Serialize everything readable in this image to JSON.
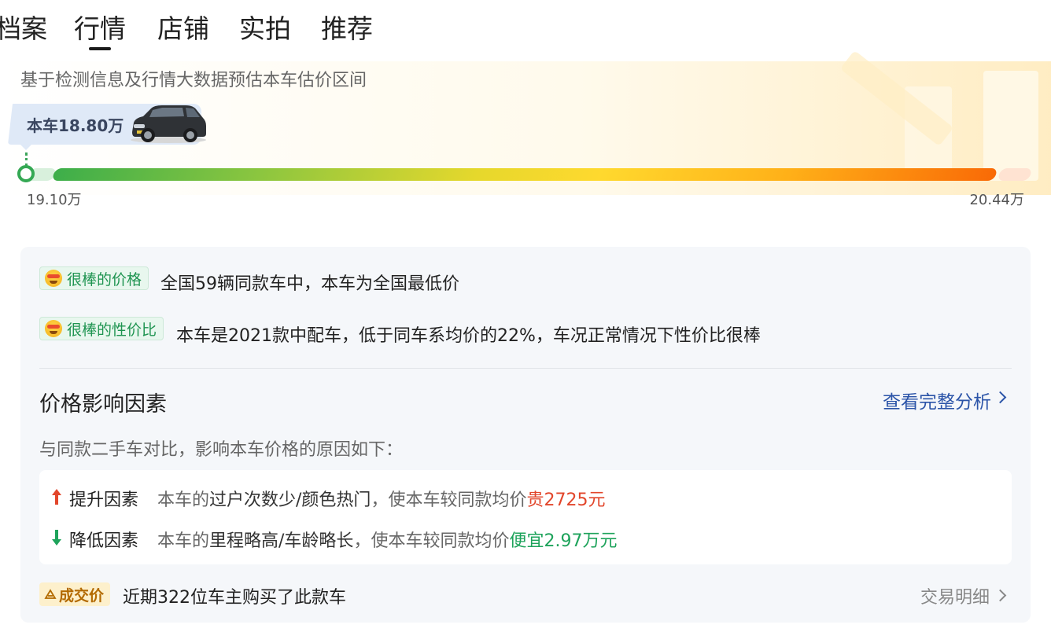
{
  "tabs": [
    {
      "label": "档案"
    },
    {
      "label": "行情",
      "active": true
    },
    {
      "label": "店铺"
    },
    {
      "label": "实拍"
    },
    {
      "label": "推荐"
    }
  ],
  "hero": {
    "subtitle": "基于检测信息及行情大数据预估本车估价区间",
    "car_price_label": "本车18.80万",
    "range_min": "19.10万",
    "range_max": "20.44万"
  },
  "highlights": [
    {
      "badge": "很棒的价格",
      "text": "全国59辆同款车中，本车为全国最低价"
    },
    {
      "badge": "很棒的性价比",
      "text": "本车是2021款中配车，低于同车系均价的22%，车况正常情况下性价比很棒"
    }
  ],
  "factors_section": {
    "title": "价格影响因素",
    "link": "查看完整分析",
    "desc": "与同款二手车对比，影响本车价格的原因如下：",
    "up": {
      "label": "提升因素",
      "prefix": "本车的",
      "items": "过户次数少/颜色热门",
      "mid": "，使本车较同款均价",
      "effect": "贵2725元"
    },
    "down": {
      "label": "降低因素",
      "prefix": "本车的",
      "items": "里程略高/车龄略长",
      "mid": "，使本车较同款均价",
      "effect": "便宜2.97万元"
    }
  },
  "deal": {
    "badge": "成交价",
    "text": "近期322位车主购买了此款车",
    "link": "交易明细"
  },
  "colors": {
    "accent_link": "#2b54a8",
    "good_green": "#1e9450",
    "up_red": "#e2462b",
    "down_green": "#1ea35b",
    "deal_badge_bg": "#fdf0cc"
  }
}
